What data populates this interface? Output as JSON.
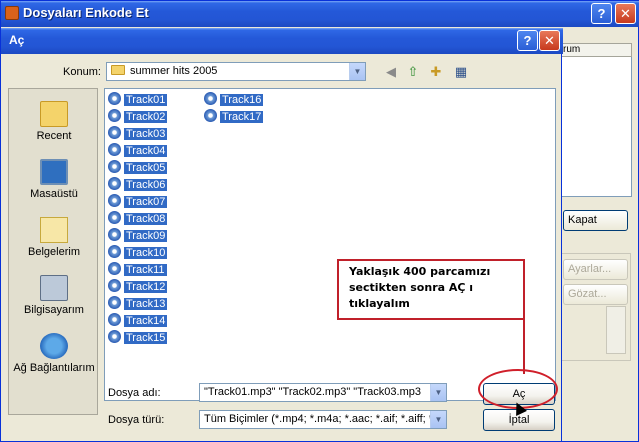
{
  "back_window": {
    "title": "Dosyaları Enkode Et",
    "help_label": "?",
    "close_label": "✕",
    "column_header": "rum",
    "kapat_label": "Kapat",
    "ayarlar_label": "Ayarlar...",
    "gozat_label": "Gözat..."
  },
  "dialog": {
    "title": "Aç",
    "help_label": "?",
    "close_label": "✕",
    "konum_label": "Konum:",
    "konum_value": "summer hits 2005",
    "places": [
      {
        "label": "Recent"
      },
      {
        "label": "Masaüstü"
      },
      {
        "label": "Belgelerim"
      },
      {
        "label": "Bilgisayarım"
      },
      {
        "label": "Ağ Bağlantılarım"
      }
    ],
    "files": [
      "Track01",
      "Track02",
      "Track03",
      "Track04",
      "Track05",
      "Track06",
      "Track07",
      "Track08",
      "Track09",
      "Track10",
      "Track11",
      "Track12",
      "Track13",
      "Track14",
      "Track15",
      "Track16",
      "Track17"
    ],
    "file_name_label": "Dosya adı:",
    "file_name_value": "\"Track01.mp3\" \"Track02.mp3\" \"Track03.mp3",
    "file_type_label": "Dosya türü:",
    "file_type_value": "Tüm Biçimler (*.mp4; *.m4a; *.aac; *.aif; *.aiff; *.",
    "open_label": "Aç",
    "cancel_label": "İptal"
  },
  "annotation": {
    "line1": "Yaklaşık 400 parcamızı",
    "line2": "sectikten sonra AÇ ı",
    "line3": "tıklayalım"
  },
  "colors": {
    "title_bar": "#2458d8",
    "selection": "#316ac5",
    "annotation_border": "#c0202a"
  }
}
